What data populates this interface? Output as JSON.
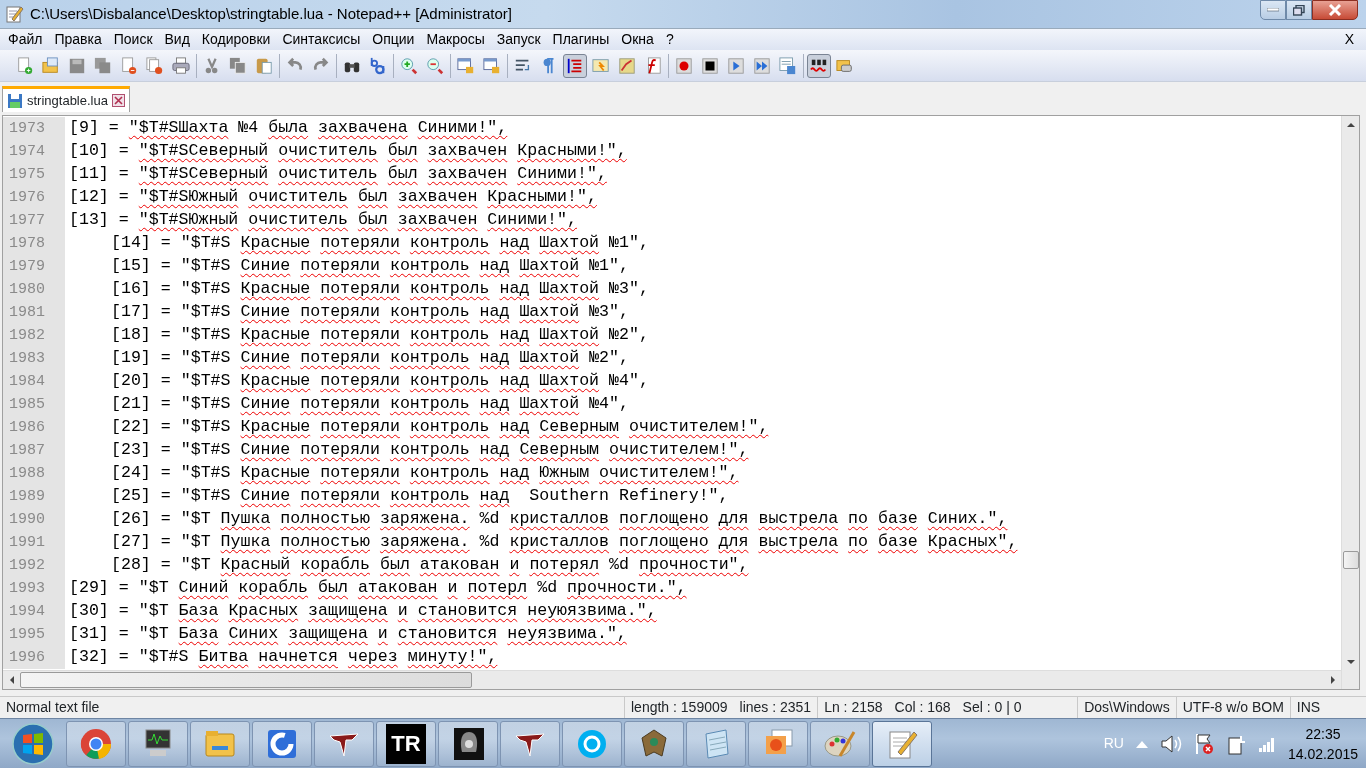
{
  "window": {
    "title": "C:\\Users\\Disbalance\\Desktop\\stringtable.lua - Notepad++ [Administrator]"
  },
  "menu": {
    "items": [
      "Файл",
      "Правка",
      "Поиск",
      "Вид",
      "Кодировки",
      "Синтаксисы",
      "Опции",
      "Макросы",
      "Запуск",
      "Плагины",
      "Окна",
      "?"
    ],
    "close_label": "X"
  },
  "toolbar_groups": [
    [
      {
        "pressed": false
      },
      {
        "pressed": false
      },
      {
        "pressed": false
      },
      {
        "pressed": false
      },
      {
        "pressed": false
      },
      {
        "pressed": false
      },
      {
        "pressed": false
      }
    ],
    [
      {
        "pressed": false
      },
      {
        "pressed": false
      },
      {
        "pressed": false
      }
    ],
    [
      {
        "pressed": false
      },
      {
        "pressed": false
      }
    ],
    [
      {
        "pressed": false
      },
      {
        "pressed": false
      }
    ],
    [
      {
        "pressed": false
      },
      {
        "pressed": false
      }
    ],
    [
      {
        "pressed": false
      },
      {
        "pressed": false
      }
    ],
    [
      {
        "pressed": false
      },
      {
        "pressed": false
      },
      {
        "pressed": true
      },
      {
        "pressed": false
      },
      {
        "pressed": false
      },
      {
        "pressed": false
      }
    ],
    [
      {
        "pressed": false
      },
      {
        "pressed": false
      },
      {
        "pressed": false
      },
      {
        "pressed": false
      },
      {
        "pressed": false
      }
    ],
    [
      {
        "pressed": true
      },
      {
        "pressed": false
      }
    ]
  ],
  "tabs": [
    {
      "label": "stringtable.lua",
      "selected": true
    }
  ],
  "editor": {
    "lines": [
      {
        "number": "1973",
        "indented": false,
        "text": "[9] = \"$T#SШахта №4 была захвачена Синими!\","
      },
      {
        "number": "1974",
        "indented": false,
        "text": "[10] = \"$T#SСеверный очиститель был захвачен Красными!\","
      },
      {
        "number": "1975",
        "indented": false,
        "text": "[11] = \"$T#SСеверный очиститель был захвачен Синими!\","
      },
      {
        "number": "1976",
        "indented": false,
        "text": "[12] = \"$T#SЮжный очиститель был захвачен Красными!\","
      },
      {
        "number": "1977",
        "indented": false,
        "text": "[13] = \"$T#SЮжный очиститель был захвачен Синими!\","
      },
      {
        "number": "1978",
        "indented": true,
        "text": "[14] = \"$T#S Красные потеряли контроль над Шахтой №1\","
      },
      {
        "number": "1979",
        "indented": true,
        "text": "[15] = \"$T#S Синие потеряли контроль над Шахтой №1\","
      },
      {
        "number": "1980",
        "indented": true,
        "text": "[16] = \"$T#S Красные потеряли контроль над Шахтой №3\","
      },
      {
        "number": "1981",
        "indented": true,
        "text": "[17] = \"$T#S Синие потеряли контроль над Шахтой №3\","
      },
      {
        "number": "1982",
        "indented": true,
        "text": "[18] = \"$T#S Красные потеряли контроль над Шахтой №2\","
      },
      {
        "number": "1983",
        "indented": true,
        "text": "[19] = \"$T#S Синие потеряли контроль над Шахтой №2\","
      },
      {
        "number": "1984",
        "indented": true,
        "text": "[20] = \"$T#S Красные потеряли контроль над Шахтой №4\","
      },
      {
        "number": "1985",
        "indented": true,
        "text": "[21] = \"$T#S Синие потеряли контроль над Шахтой №4\","
      },
      {
        "number": "1986",
        "indented": true,
        "text": "[22] = \"$T#S Красные потеряли контроль над Северным очистителем!\","
      },
      {
        "number": "1987",
        "indented": true,
        "text": "[23] = \"$T#S Синие потеряли контроль над Северным очистителем!\","
      },
      {
        "number": "1988",
        "indented": true,
        "text": "[24] = \"$T#S Красные потеряли контроль над Южным очистителем!\","
      },
      {
        "number": "1989",
        "indented": true,
        "text": "[25] = \"$T#S Синие потеряли контроль над  Southern Refinery!\","
      },
      {
        "number": "1990",
        "indented": true,
        "text": "[26] = \"$T Пушка полностью заряжена. %d кристаллов поглощено для выстрела по базе Синих.\","
      },
      {
        "number": "1991",
        "indented": true,
        "text": "[27] = \"$T Пушка полностью заряжена. %d кристаллов поглощено для выстрела по базе Красных\","
      },
      {
        "number": "1992",
        "indented": true,
        "text": "[28] = \"$T Красный корабль был атакован и потерял %d прочности\","
      },
      {
        "number": "1993",
        "indented": false,
        "text": "[29] = \"$T Синий корабль был атакован и потерл %d прочности.\","
      },
      {
        "number": "1994",
        "indented": false,
        "text": "[30] = \"$T База Красных защищена и становится неуюязвима.\","
      },
      {
        "number": "1995",
        "indented": false,
        "text": "[31] = \"$T База Синих защищена и становится неуязвима.\","
      },
      {
        "number": "1996",
        "indented": false,
        "text": "[32] = \"$T#S Битва начнется через минуту!\","
      }
    ]
  },
  "status_bar": {
    "file_type": "Normal text file",
    "length": "length : 159009",
    "lines": "lines : 2351",
    "ln": "Ln : 2158",
    "col": "Col : 168",
    "sel": "Sel : 0 | 0",
    "eol": "Dos\\Windows",
    "encoding": "UTF-8 w/o BOM",
    "mode": "INS"
  },
  "taskbar": {
    "buttons": [
      {
        "selected": false
      },
      {
        "selected": false
      },
      {
        "selected": false
      },
      {
        "selected": false
      },
      {
        "selected": false
      },
      {
        "selected": false,
        "label": "TR"
      },
      {
        "selected": false
      },
      {
        "selected": false
      },
      {
        "selected": false
      },
      {
        "selected": false
      },
      {
        "selected": false
      },
      {
        "selected": false
      },
      {
        "selected": false
      },
      {
        "selected": true
      }
    ],
    "language": "RU",
    "time": "22:35",
    "date": "14.02.2015"
  }
}
